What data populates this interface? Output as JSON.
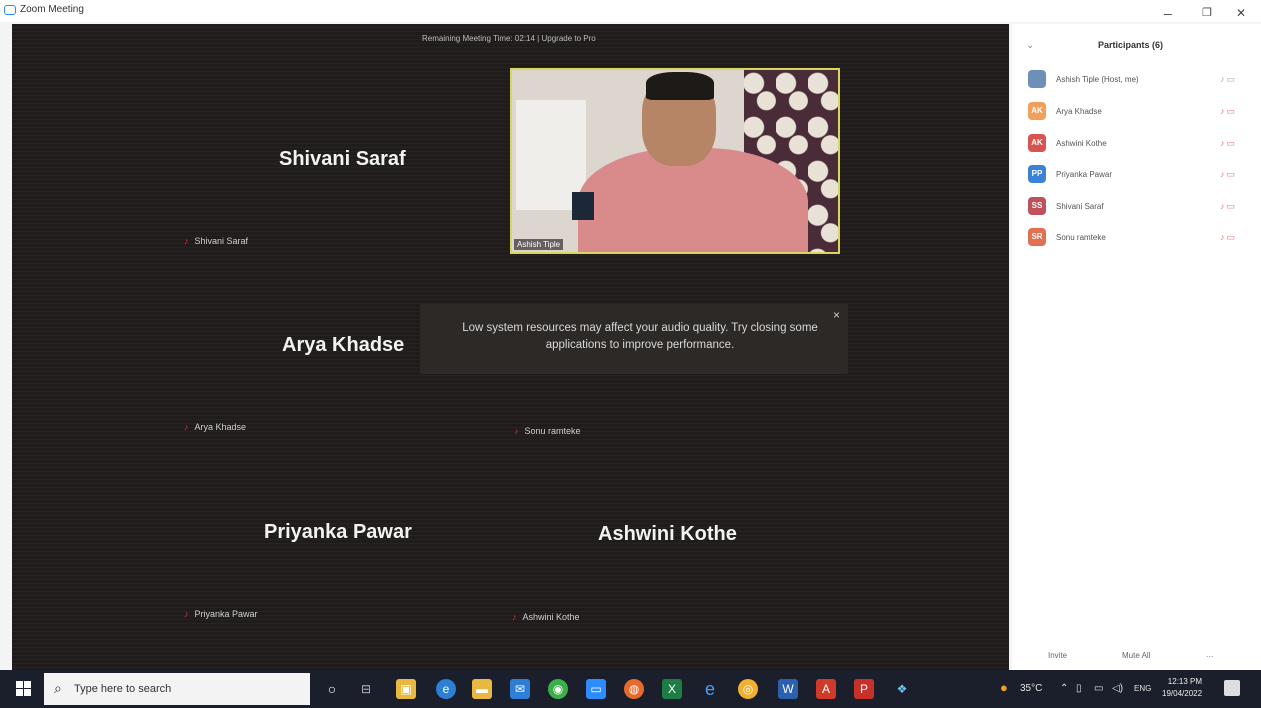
{
  "window": {
    "title": "Zoom Meeting",
    "controls": {
      "minimize": "–",
      "restore": "❐",
      "close": "✕"
    }
  },
  "meeting": {
    "top_banner": "Remaining Meeting Time: 02:14 | Upgrade to Pro",
    "tiles": [
      {
        "display_name": "Shivani Saraf",
        "label": "Shivani Saraf"
      },
      {
        "display_name": "Arya Khadse",
        "label": "Arya Khadse"
      },
      {
        "display_name": "",
        "label": "Sonu ramteke"
      },
      {
        "display_name": "Priyanka Pawar",
        "label": "Priyanka Pawar"
      },
      {
        "display_name": "Ashwini Kothe",
        "label": "Ashwini Kothe"
      }
    ],
    "active_video": {
      "name_tag": "Ashish Tiple"
    },
    "toast": {
      "message": "Low system resources may affect your audio quality. Try closing some applications to improve performance.",
      "close": "×"
    }
  },
  "participants_panel": {
    "title": "Participants (6)",
    "participants": [
      {
        "initials": "",
        "name": "Ashish Tiple (Host, me)",
        "color": "#4a7bd6"
      },
      {
        "initials": "AK",
        "name": "Arya Khadse",
        "color": "#f0a05a"
      },
      {
        "initials": "AK",
        "name": "Ashwini Kothe",
        "color": "#d9534f"
      },
      {
        "initials": "PP",
        "name": "Priyanka Pawar",
        "color": "#3b82d6"
      },
      {
        "initials": "SS",
        "name": "Shivani Saraf",
        "color": "#c0505a"
      },
      {
        "initials": "SR",
        "name": "Sonu ramteke",
        "color": "#e07050"
      }
    ],
    "invite_label": "Invite",
    "mute_all_label": "Mute All",
    "more_label": "..."
  },
  "taskbar": {
    "search_placeholder": "Type here to search",
    "temperature": "35°C",
    "language": "ENG",
    "time": "12:13 PM",
    "date": "19/04/2022"
  }
}
